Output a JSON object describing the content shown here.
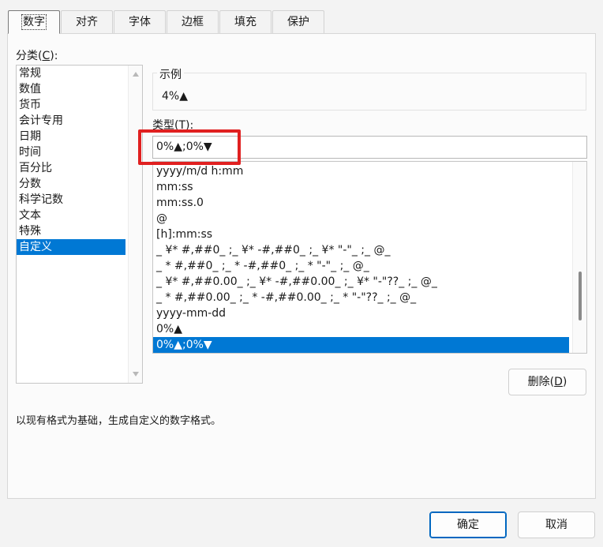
{
  "tabs": [
    "数字",
    "对齐",
    "字体",
    "边框",
    "填充",
    "保护"
  ],
  "category": {
    "label_prefix": "分类(",
    "label_key": "C",
    "label_suffix": "):",
    "items": [
      "常规",
      "数值",
      "货币",
      "会计专用",
      "日期",
      "时间",
      "百分比",
      "分数",
      "科学记数",
      "文本",
      "特殊",
      "自定义"
    ],
    "selected": "自定义"
  },
  "sample": {
    "title": "示例",
    "value": "4%▲"
  },
  "type": {
    "label_prefix": "类型(",
    "label_key": "T",
    "label_suffix": "):",
    "value": "0%▲;0%▼"
  },
  "formats": [
    "yyyy/m/d h:mm",
    "mm:ss",
    "mm:ss.0",
    "@",
    "[h]:mm:ss",
    "_ ¥* #,##0_ ;_ ¥* -#,##0_ ;_ ¥* \"-\"_ ;_ @_",
    "_ * #,##0_ ;_ * -#,##0_ ;_ * \"-\"_ ;_ @_",
    "_ ¥* #,##0.00_ ;_ ¥* -#,##0.00_ ;_ ¥* \"-\"??_ ;_ @_",
    "_ * #,##0.00_ ;_ * -#,##0.00_ ;_ * \"-\"??_ ;_ @_",
    "yyyy-mm-dd",
    "0%▲",
    "0%▲;0%▼"
  ],
  "selected_format": "0%▲;0%▼",
  "delete_button": {
    "prefix": "删除(",
    "key": "D",
    "suffix": ")"
  },
  "description": "以现有格式为基础，生成自定义的数字格式。",
  "ok_label": "确定",
  "cancel_label": "取消",
  "colors": {
    "accent": "#0078d4",
    "highlight": "#e02020"
  },
  "format_list_scroll": 0.9
}
